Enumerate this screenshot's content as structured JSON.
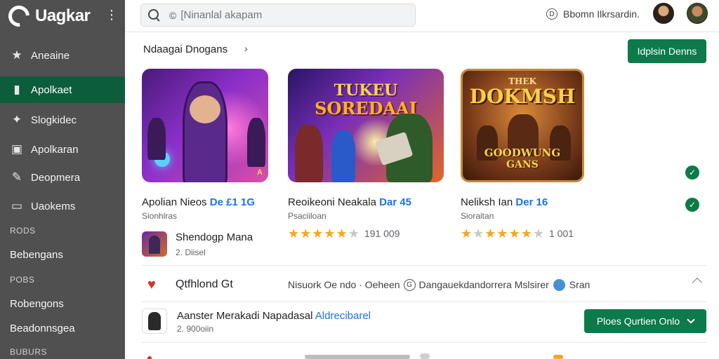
{
  "sidebar": {
    "brand": "Uagkar",
    "items": [
      {
        "label": "Aneaine",
        "icon": "star-icon"
      },
      {
        "label": "Apolkaet",
        "icon": "bar-chart-icon"
      },
      {
        "label": "Slogkidec",
        "icon": "puzzle-icon"
      },
      {
        "label": "Apolkaran",
        "icon": "image-icon"
      },
      {
        "label": "Deopmera",
        "icon": "magic-wand-icon"
      },
      {
        "label": "Uaokems",
        "icon": "monitor-icon"
      }
    ],
    "section1": "RODS",
    "link1": "Bebengans",
    "section2": "POBS",
    "link2": "Robengons",
    "link3": "Beadonnsgea",
    "section3": "BUBURS"
  },
  "topbar": {
    "search_placeholder": "[Ninanlal akapam",
    "search_prefix": "©",
    "account_label": "Bbomn Ilkrsardin.",
    "account_icon": "D"
  },
  "main": {
    "section_title": "Ndaagai Dnogans",
    "section_arrow": "›",
    "cta": "Idplsin Denns",
    "cards": [
      {
        "name": "Apolian Nieos",
        "highlight": "De £1 1G",
        "sub": "Sionhlras",
        "mini_title": "Shendogp Mana",
        "mini_sub": "2. Diisel",
        "art_text": "",
        "art_badge": "A"
      },
      {
        "name": "Reoikeoni Neakala",
        "highlight": "Dar 45",
        "sub": "Psaciiloan",
        "stars": 5,
        "rating_count": "191 009",
        "art_text": "SOREDAAI",
        "art_top": "TUKEU"
      },
      {
        "name": "Neliksh Ian",
        "highlight": "Der 16",
        "sub": "Sioraitan",
        "stars": 5,
        "rating_count": "1 001",
        "art_text": "DOKMSH",
        "art_top": "THEK",
        "art_bottom1": "GOODWUNG",
        "art_bottom2": "GANS"
      }
    ],
    "row1": {
      "label": "Qtfhlond Gt",
      "meta_a": "Nisuork Oe ndo · Oeheen",
      "meta_icon": "G",
      "meta_b": "Dangauekdandorrera Mslsirer",
      "meta_c": "Sran"
    },
    "row2": {
      "title": "Aanster Merakadi Napadasal",
      "highlight": "Aldrecibarel",
      "sub": "2. 900oiin",
      "button": "Ploes Qurtien Onlo"
    }
  }
}
